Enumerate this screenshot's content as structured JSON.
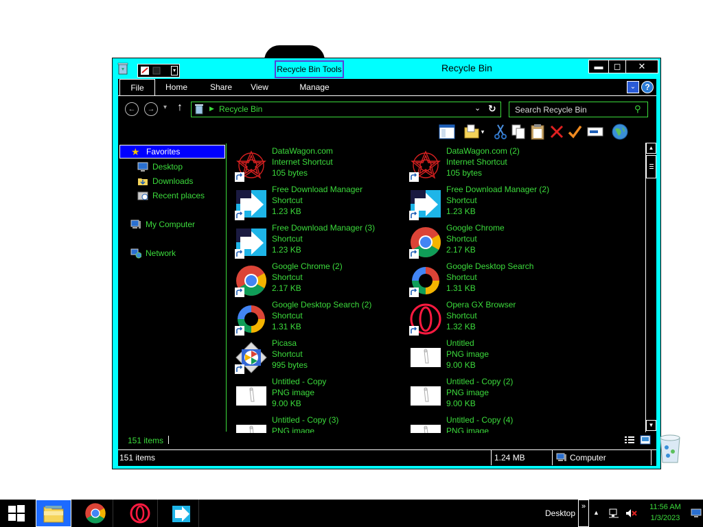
{
  "window": {
    "title": "Recycle Bin",
    "tools_tab": "Recycle Bin Tools",
    "minimize": "▬",
    "maximize": "◻",
    "close": "✕"
  },
  "ribbon": {
    "tabs": [
      "File",
      "Home",
      "Share",
      "View",
      "Manage"
    ],
    "expand": "⌄",
    "help": "?"
  },
  "address": {
    "location": "Recycle Bin",
    "search_placeholder": "Search Recycle Bin"
  },
  "nav_pane": {
    "favorites": "Favorites",
    "desktop": "Desktop",
    "downloads": "Downloads",
    "recent": "Recent places",
    "computer": "My Computer",
    "network": "Network"
  },
  "files": [
    {
      "name": "DataWagon.com",
      "type": "Internet Shortcut",
      "size": "105 bytes",
      "icon": "datawagon-icon"
    },
    {
      "name": "DataWagon.com (2)",
      "type": "Internet Shortcut",
      "size": "105 bytes",
      "icon": "datawagon-icon"
    },
    {
      "name": "Free Download Manager",
      "type": "Shortcut",
      "size": "1.23 KB",
      "icon": "fdm-icon"
    },
    {
      "name": "Free Download Manager (2)",
      "type": "Shortcut",
      "size": "1.23 KB",
      "icon": "fdm-icon"
    },
    {
      "name": "Free Download Manager (3)",
      "type": "Shortcut",
      "size": "1.23 KB",
      "icon": "fdm-icon"
    },
    {
      "name": "Google Chrome",
      "type": "Shortcut",
      "size": "2.17 KB",
      "icon": "chrome-icon"
    },
    {
      "name": "Google Chrome (2)",
      "type": "Shortcut",
      "size": "2.17 KB",
      "icon": "chrome-icon"
    },
    {
      "name": "Google Desktop Search",
      "type": "Shortcut",
      "size": "1.31 KB",
      "icon": "google-desktop-icon"
    },
    {
      "name": "Google Desktop Search (2)",
      "type": "Shortcut",
      "size": "1.31 KB",
      "icon": "google-desktop-icon"
    },
    {
      "name": "Opera GX Browser",
      "type": "Shortcut",
      "size": "1.32 KB",
      "icon": "opera-icon"
    },
    {
      "name": "Picasa",
      "type": "Shortcut",
      "size": "995 bytes",
      "icon": "picasa-icon"
    },
    {
      "name": "Untitled",
      "type": "PNG image",
      "size": "9.00 KB",
      "icon": "png-thumbnail-icon"
    },
    {
      "name": "Untitled - Copy",
      "type": "PNG image",
      "size": "9.00 KB",
      "icon": "png-thumbnail-icon"
    },
    {
      "name": "Untitled - Copy (2)",
      "type": "PNG image",
      "size": "9.00 KB",
      "icon": "png-thumbnail-icon"
    },
    {
      "name": "Untitled - Copy (3)",
      "type": "PNG image",
      "size": "",
      "icon": "png-thumbnail-icon"
    },
    {
      "name": "Untitled - Copy (4)",
      "type": "PNG image",
      "size": "",
      "icon": "png-thumbnail-icon"
    }
  ],
  "status": {
    "items_count": "151 items",
    "sb_items": "151 items",
    "sb_size": "1.24 MB",
    "sb_location": "Computer"
  },
  "taskbar": {
    "desktop_label": "Desktop",
    "chevron": "»",
    "time": "11:56 AM",
    "date": "1/3/2023"
  },
  "colors": {
    "frame": "#00ffff",
    "text_green": "#3cdc3c",
    "selection": "#0000ff",
    "background": "#000000"
  }
}
